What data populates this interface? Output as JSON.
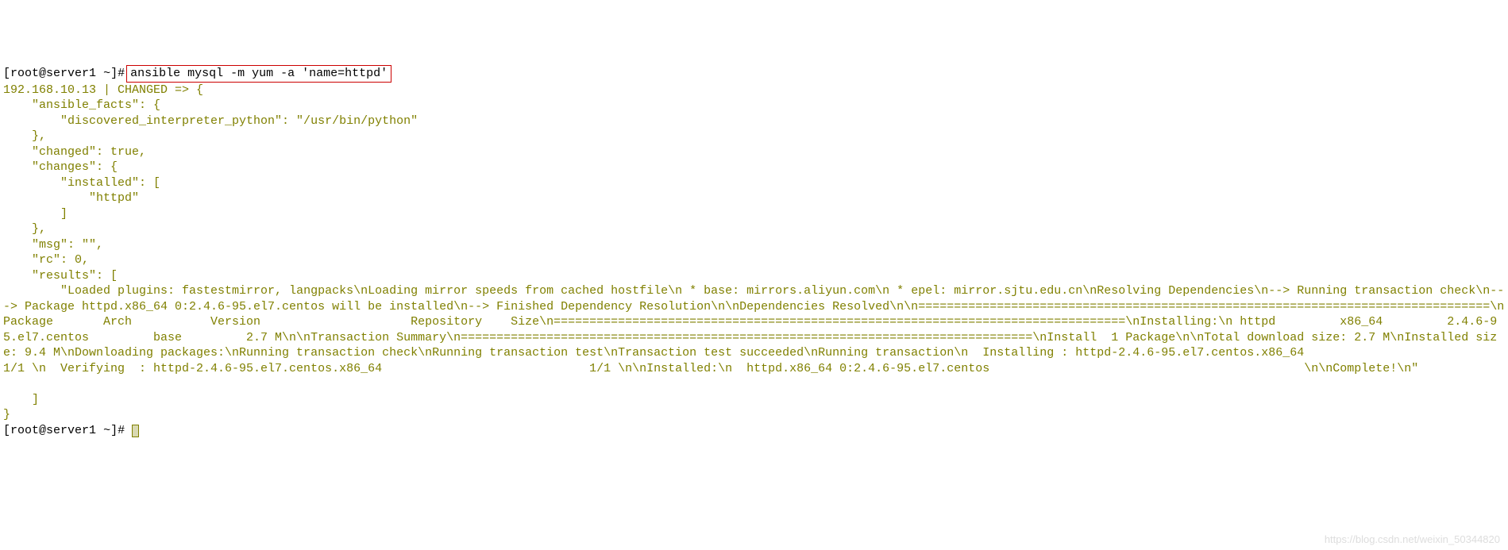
{
  "prompt1": {
    "user": "root",
    "host": "server1",
    "dir": "~",
    "symbol": "#",
    "command": "ansible mysql -m yum -a 'name=httpd'"
  },
  "output": {
    "header": "192.168.10.13 | CHANGED => {",
    "line_facts_open": "    \"ansible_facts\": {",
    "line_interpreter": "        \"discovered_interpreter_python\": \"/usr/bin/python\"",
    "line_facts_close": "    },",
    "line_changed": "    \"changed\": true,",
    "line_changes_open": "    \"changes\": {",
    "line_installed_open": "        \"installed\": [",
    "line_httpd": "            \"httpd\"",
    "line_installed_close": "        ]",
    "line_changes_close": "    },",
    "line_msg": "    \"msg\": \"\",",
    "line_rc": "    \"rc\": 0,",
    "line_results_open": "    \"results\": [",
    "results_text": "        \"Loaded plugins: fastestmirror, langpacks\\nLoading mirror speeds from cached hostfile\\n * base: mirrors.aliyun.com\\n * epel: mirror.sjtu.edu.cn\\nResolving Dependencies\\n--> Running transaction check\\n---> Package httpd.x86_64 0:2.4.6-95.el7.centos will be installed\\n--> Finished Dependency Resolution\\n\\nDependencies Resolved\\n\\n================================================================================\\n Package       Arch           Version                     Repository    Size\\n================================================================================\\nInstalling:\\n httpd         x86_64         2.4.6-95.el7.centos         base         2.7 M\\n\\nTransaction Summary\\n================================================================================\\nInstall  1 Package\\n\\nTotal download size: 2.7 M\\nInstalled size: 9.4 M\\nDownloading packages:\\nRunning transaction check\\nRunning transaction test\\nTransaction test succeeded\\nRunning transaction\\n  Installing : httpd-2.4.6-95.el7.centos.x86_64                             1/1 \\n  Verifying  : httpd-2.4.6-95.el7.centos.x86_64                             1/1 \\n\\nInstalled:\\n  httpd.x86_64 0:2.4.6-95.el7.centos                                            \\n\\nComplete!\\n\"",
    "line_results_close": "    ]",
    "line_outer_close": "}"
  },
  "prompt2": {
    "user": "root",
    "host": "server1",
    "dir": "~",
    "symbol": "#"
  },
  "watermark": "https://blog.csdn.net/weixin_50344820"
}
